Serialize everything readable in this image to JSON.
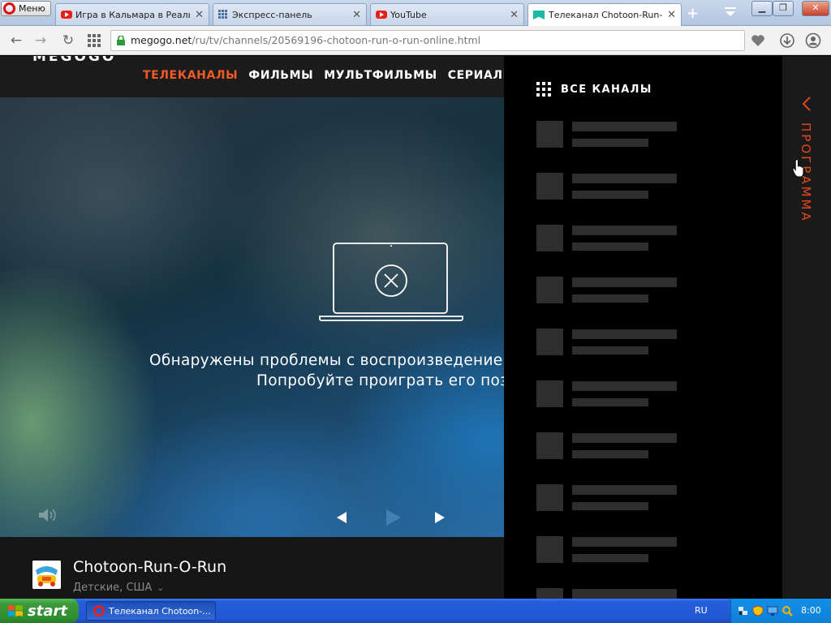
{
  "browser": {
    "menu_label": "Меню",
    "tabs": [
      {
        "title": "Игра в Кальмара в Реальн",
        "icon": "youtube-icon"
      },
      {
        "title": "Экспресс-панель",
        "icon": "speed-dial-icon"
      },
      {
        "title": "YouTube",
        "icon": "youtube-icon"
      },
      {
        "title": "Телеканал Chotoon-Run-O-R",
        "icon": "megogo-icon",
        "active": true
      }
    ],
    "url_host": "megogo.net",
    "url_path": "/ru/tv/channels/20569196-chotoon-run-o-run-online.html"
  },
  "site": {
    "logo": "MEGOGO",
    "nav": [
      "ТЕЛЕКАНАЛЫ",
      "ФИЛЬМЫ",
      "МУЛЬТФИЛЬМЫ",
      "СЕРИАЛЫ И"
    ],
    "accent_color": "#f05a28"
  },
  "player": {
    "error_line1": "Обнаружены проблемы с воспроизведением",
    "error_line2": "Попробуйте проиграть его позже"
  },
  "channel": {
    "title": "Chotoon-Run-O-Run",
    "meta": "Детские, США"
  },
  "sidebar": {
    "all_channels_label": "ВСЕ КАНАЛЫ",
    "program_label": "ПРОГРАММА"
  },
  "taskbar": {
    "start_label": "start",
    "task_label": "Телеканал Chotoon-...",
    "language": "RU",
    "clock": "8:00"
  }
}
